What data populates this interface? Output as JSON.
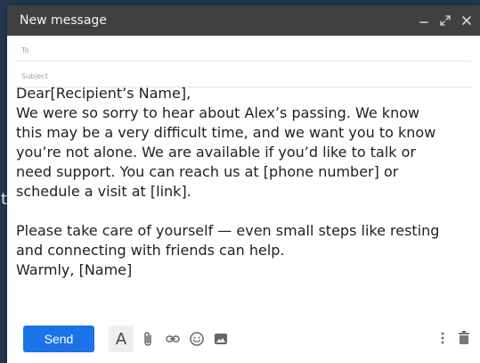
{
  "background_fragment": "t",
  "window": {
    "title": "New message",
    "controls": {
      "minimize": "minimize-icon",
      "expand": "expand-icon",
      "close": "close-icon"
    }
  },
  "fields": {
    "to_label": "To",
    "subject_label": "Subject"
  },
  "body": {
    "lines": [
      "Dear[Recipient’s Name],",
      "We were so sorry to hear about Alex’s passing. We know",
      "this may be a very difficult time, and we want you to know",
      "you’re not alone. We are available if you’d like to talk or",
      "need support. You can reach us at [phone number] or",
      "schedule a visit at [link].",
      "",
      "Please take care of yourself — even small steps like resting",
      "and connecting with friends can help.",
      "Warmly, [Name]"
    ]
  },
  "toolbar": {
    "send_label": "Send",
    "format_label": "A",
    "icons": [
      "attachment-icon",
      "link-icon",
      "emoji-icon",
      "image-icon",
      "more-options-icon",
      "trash-icon"
    ]
  },
  "colors": {
    "titlebar": "#404040",
    "send_button": "#1a73e8",
    "page_background": "#22384f"
  }
}
